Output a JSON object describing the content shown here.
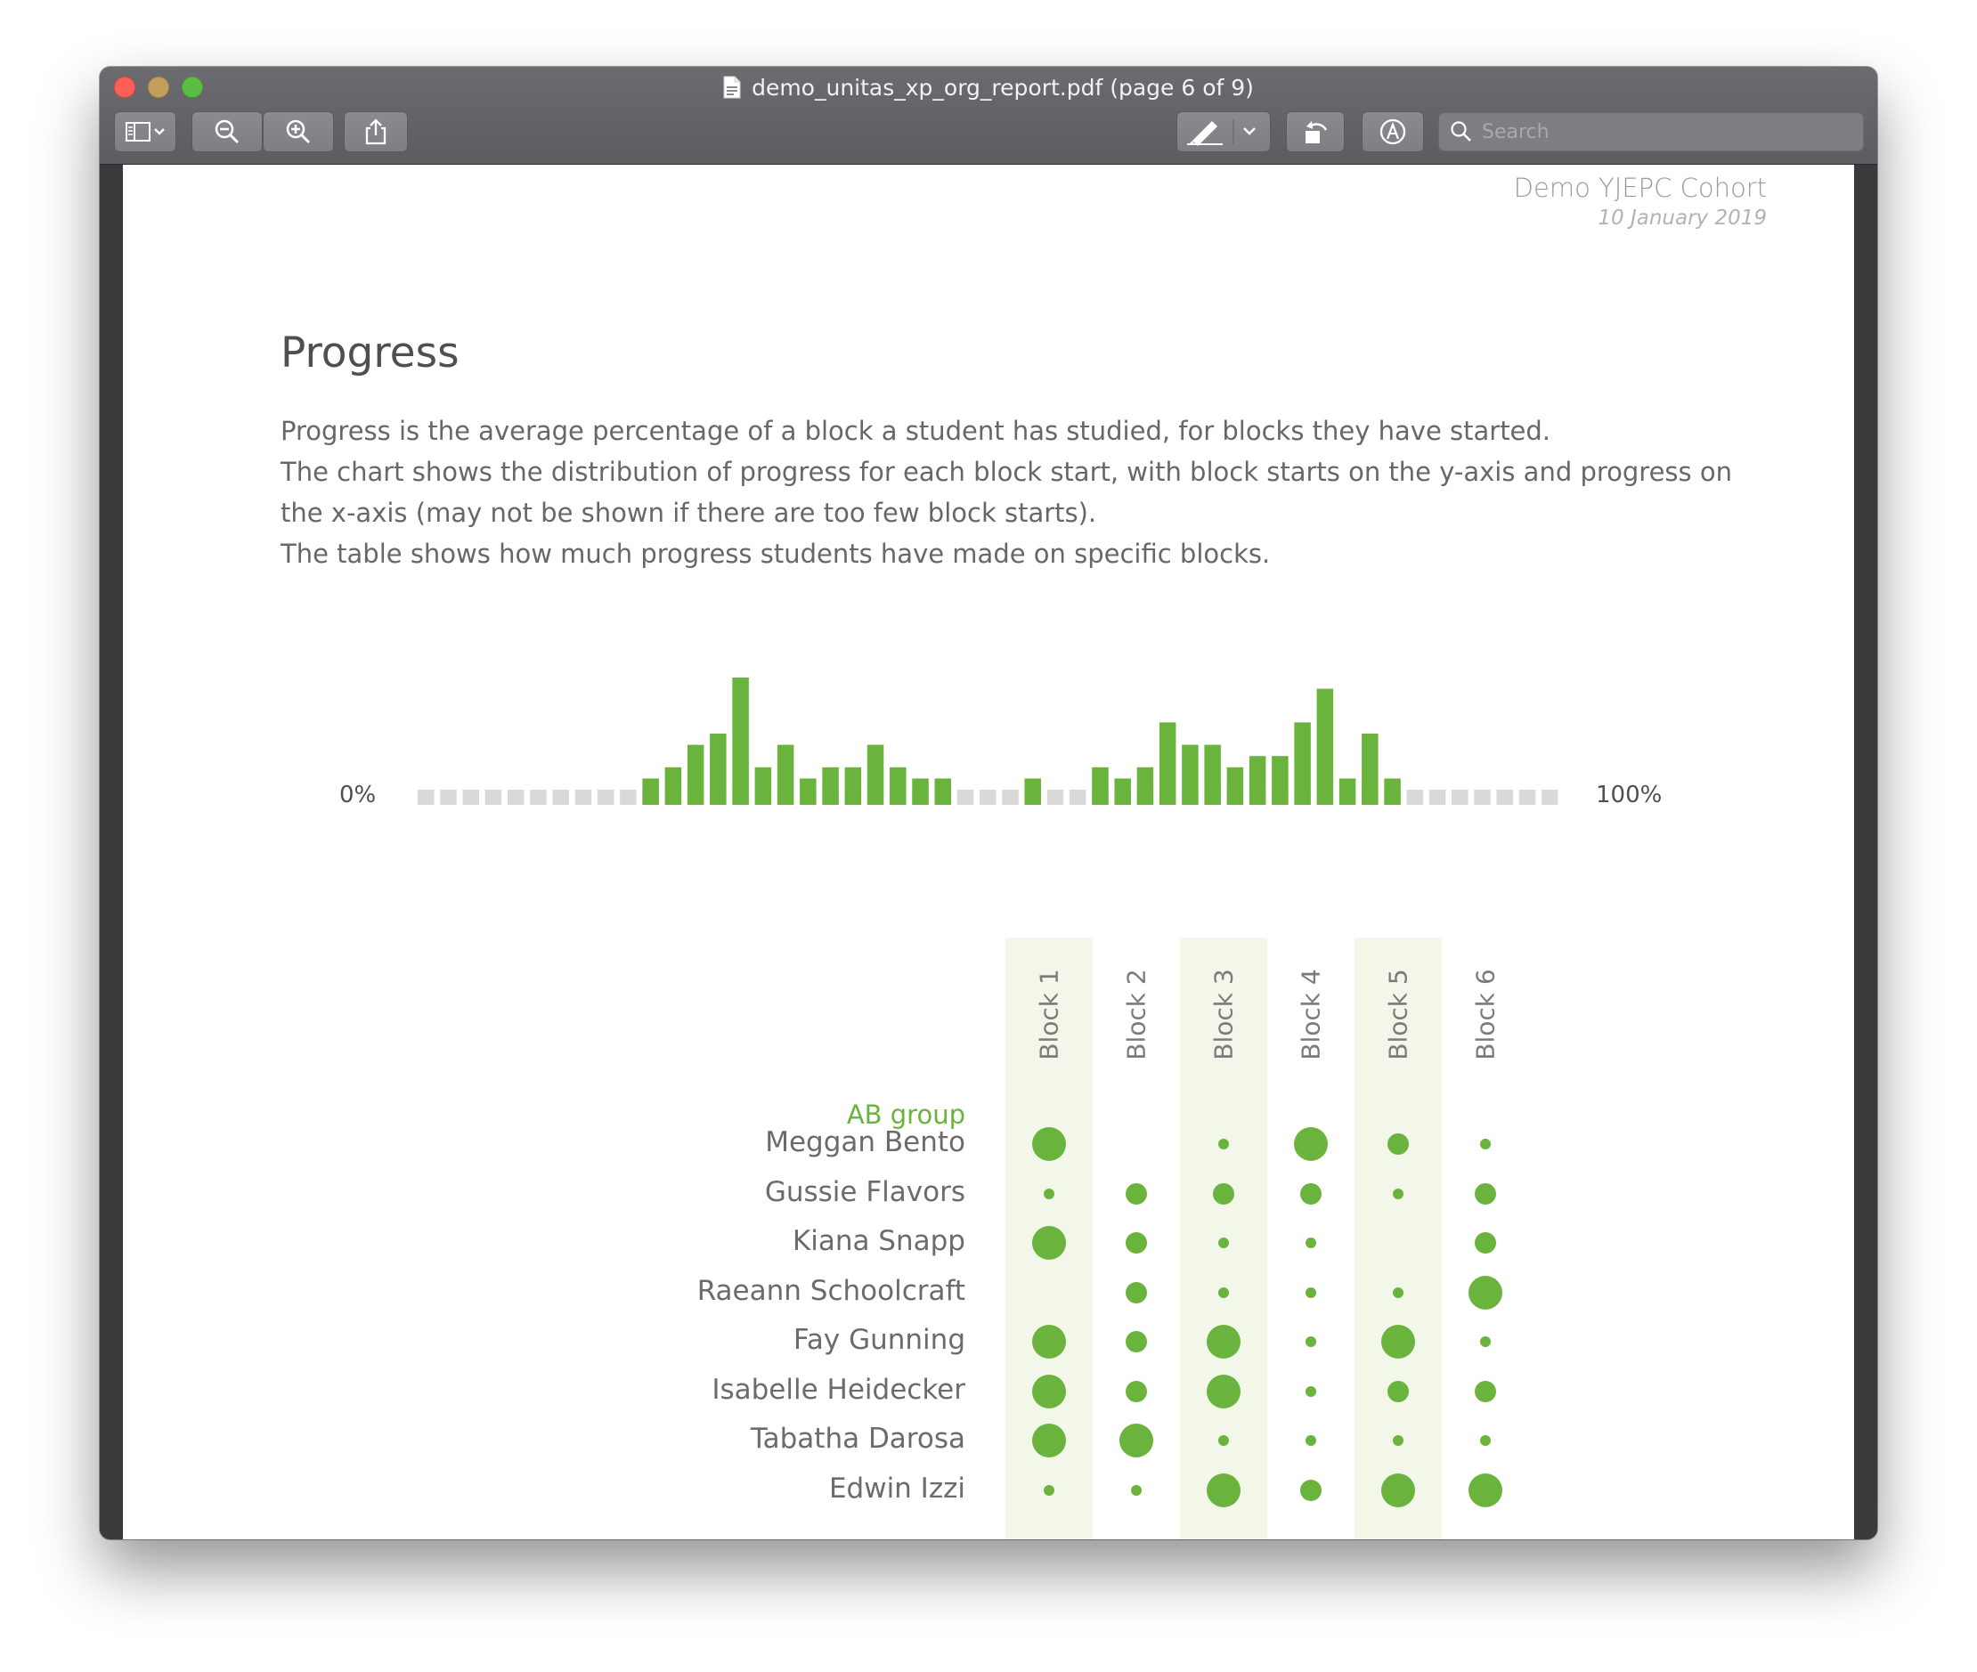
{
  "window": {
    "title": "demo_unitas_xp_org_report.pdf (page 6 of 9)"
  },
  "toolbar": {
    "buttons": [
      {
        "name": "sidebar-toggle",
        "icon": "sidebar-icon"
      },
      {
        "name": "zoom-out",
        "icon": "zoom-out-icon"
      },
      {
        "name": "zoom-in",
        "icon": "zoom-in-icon"
      },
      {
        "name": "share",
        "icon": "share-icon"
      },
      {
        "name": "markup",
        "icon": "pen-icon"
      },
      {
        "name": "rotate",
        "icon": "rotate-icon"
      },
      {
        "name": "annotate",
        "icon": "markup-circle-icon"
      }
    ],
    "search_placeholder": "Search"
  },
  "page": {
    "cohort_name": "Demo YJEPC Cohort",
    "cohort_date": "10 January 2019",
    "heading": "Progress",
    "description": [
      "Progress is the average percentage of a block a student has studied, for blocks they have started.",
      "The chart shows the distribution of progress for each block start, with block starts on the y-axis and progress on the x-axis (may not be shown if there are too few block starts).",
      "The table shows how much progress students have made on specific blocks."
    ]
  },
  "chart_data": {
    "type": "bar",
    "xlabel_left": "0%",
    "xlabel_right": "100%",
    "bins": 51,
    "values": [
      0,
      0,
      0,
      0,
      0,
      0,
      0,
      0,
      0,
      0,
      1,
      2,
      4,
      5,
      10,
      2,
      4,
      1,
      2,
      2,
      4,
      2,
      1,
      1,
      0,
      0,
      0,
      1,
      0,
      0,
      2,
      1,
      2,
      6,
      4,
      4,
      2,
      3,
      3,
      6,
      9,
      1,
      5,
      1,
      0,
      0,
      0,
      0,
      0,
      0,
      0
    ],
    "colors": {
      "bar": "#6ab43e",
      "baseline": "#d9d9d9"
    }
  },
  "table": {
    "columns": [
      "Block 1",
      "Block 2",
      "Block 3",
      "Block 4",
      "Block 5",
      "Block 6"
    ],
    "group": "AB group",
    "rows": [
      {
        "name": "Meggan Bento",
        "values": [
          3,
          0,
          1,
          3,
          2,
          1
        ]
      },
      {
        "name": "Gussie Flavors",
        "values": [
          1,
          2,
          2,
          2,
          1,
          2
        ]
      },
      {
        "name": "Kiana Snapp",
        "values": [
          3,
          2,
          1,
          1,
          0,
          2
        ]
      },
      {
        "name": "Raeann Schoolcraft",
        "values": [
          0,
          2,
          1,
          1,
          1,
          3
        ]
      },
      {
        "name": "Fay Gunning",
        "values": [
          3,
          2,
          3,
          1,
          3,
          1
        ]
      },
      {
        "name": "Isabelle Heidecker",
        "values": [
          3,
          2,
          3,
          1,
          2,
          2
        ]
      },
      {
        "name": "Tabatha Darosa",
        "values": [
          3,
          3,
          1,
          1,
          1,
          1
        ]
      },
      {
        "name": "Edwin Izzi",
        "values": [
          1,
          1,
          3,
          2,
          3,
          3
        ]
      }
    ],
    "accent_color": "#6ab43e"
  }
}
